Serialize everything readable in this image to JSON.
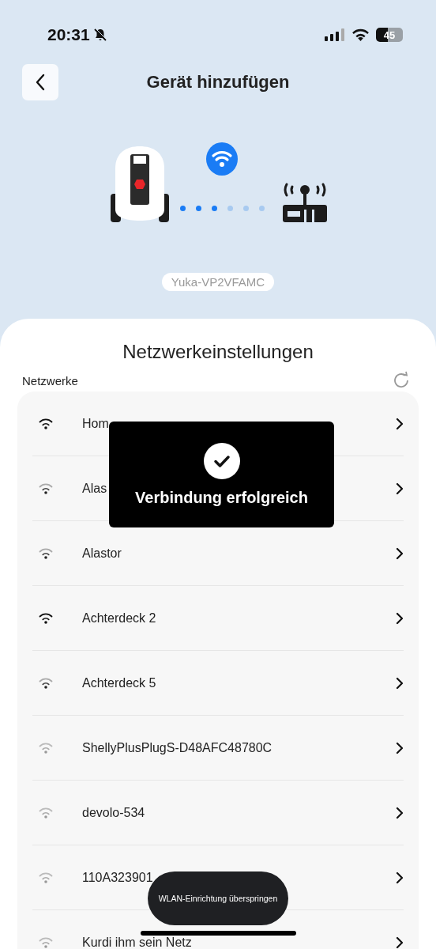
{
  "status_bar": {
    "time": "20:31",
    "battery": "45",
    "silent": true
  },
  "header": {
    "title": "Gerät hinzufügen"
  },
  "device": {
    "name": "Yuka-VP2VFAMC",
    "progress_dots": [
      {
        "done": true
      },
      {
        "done": true
      },
      {
        "done": true
      },
      {
        "done": false
      },
      {
        "done": false
      },
      {
        "done": false
      }
    ]
  },
  "sheet": {
    "title": "Netzwerkeinstellungen",
    "section_label": "Netzwerke"
  },
  "networks": [
    {
      "name": "Hom",
      "kind": "strong"
    },
    {
      "name": "Alas",
      "kind": "medium"
    },
    {
      "name": "Alastor",
      "kind": "medium"
    },
    {
      "name": "Achterdeck 2",
      "kind": "strong"
    },
    {
      "name": "Achterdeck 5",
      "kind": "medium"
    },
    {
      "name": "ShellyPlusPlugS-D48AFC48780C",
      "kind": "weak"
    },
    {
      "name": "devolo-534",
      "kind": "weak"
    },
    {
      "name": "110A323901",
      "kind": "weak"
    },
    {
      "name": "Kurdi ihm sein Netz",
      "kind": "weak"
    }
  ],
  "toast": {
    "message": "Verbindung erfolgreich"
  },
  "skip_button": {
    "label": "WLAN-Einrichtung überspringen"
  }
}
